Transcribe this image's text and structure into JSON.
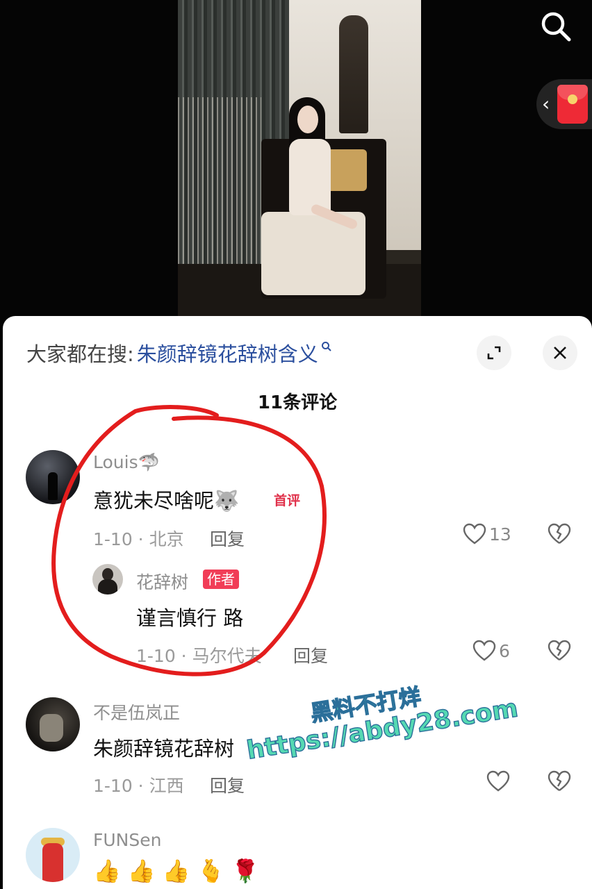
{
  "video": {
    "search_icon": "search-icon",
    "redpack_icon": "red-envelope-icon"
  },
  "comments_panel": {
    "search_prefix": "大家都在搜:",
    "search_query": "朱颜辞镜花辞树含义",
    "search_mini_icon": "search-icon",
    "expand_icon": "expand-icon",
    "close_icon": "close-icon",
    "count_label": "11条评论"
  },
  "comments": [
    {
      "user": "Louis",
      "user_emoji": "🦈",
      "text": "意犹未尽啥呢",
      "text_emoji": "🐺",
      "badge": "首评",
      "meta": "1-10 · 北京",
      "reply_label": "回复",
      "likes": "13",
      "replies": [
        {
          "user": "花辞树",
          "badge": "作者",
          "text": "谨言慎行 路",
          "meta": "1-10 · 马尔代夫",
          "reply_label": "回复",
          "likes": "6"
        }
      ]
    },
    {
      "user": "不是伍岚正",
      "text": "朱颜辞镜花辞树",
      "meta": "1-10 · 江西",
      "reply_label": "回复",
      "likes": ""
    },
    {
      "user": "FUNSen",
      "emojis": [
        "👍",
        "👍",
        "👍",
        "🫰",
        "🌹"
      ]
    }
  ],
  "watermark": {
    "line1": "黑料不打烊",
    "line2": "https://abdy28.com"
  },
  "colors": {
    "link": "#2b4f9e",
    "first_badge": "#e0304a",
    "author_badge": "#f13d57",
    "annotation_circle": "#e31d1d",
    "watermark_fill": "#55d9b2"
  }
}
